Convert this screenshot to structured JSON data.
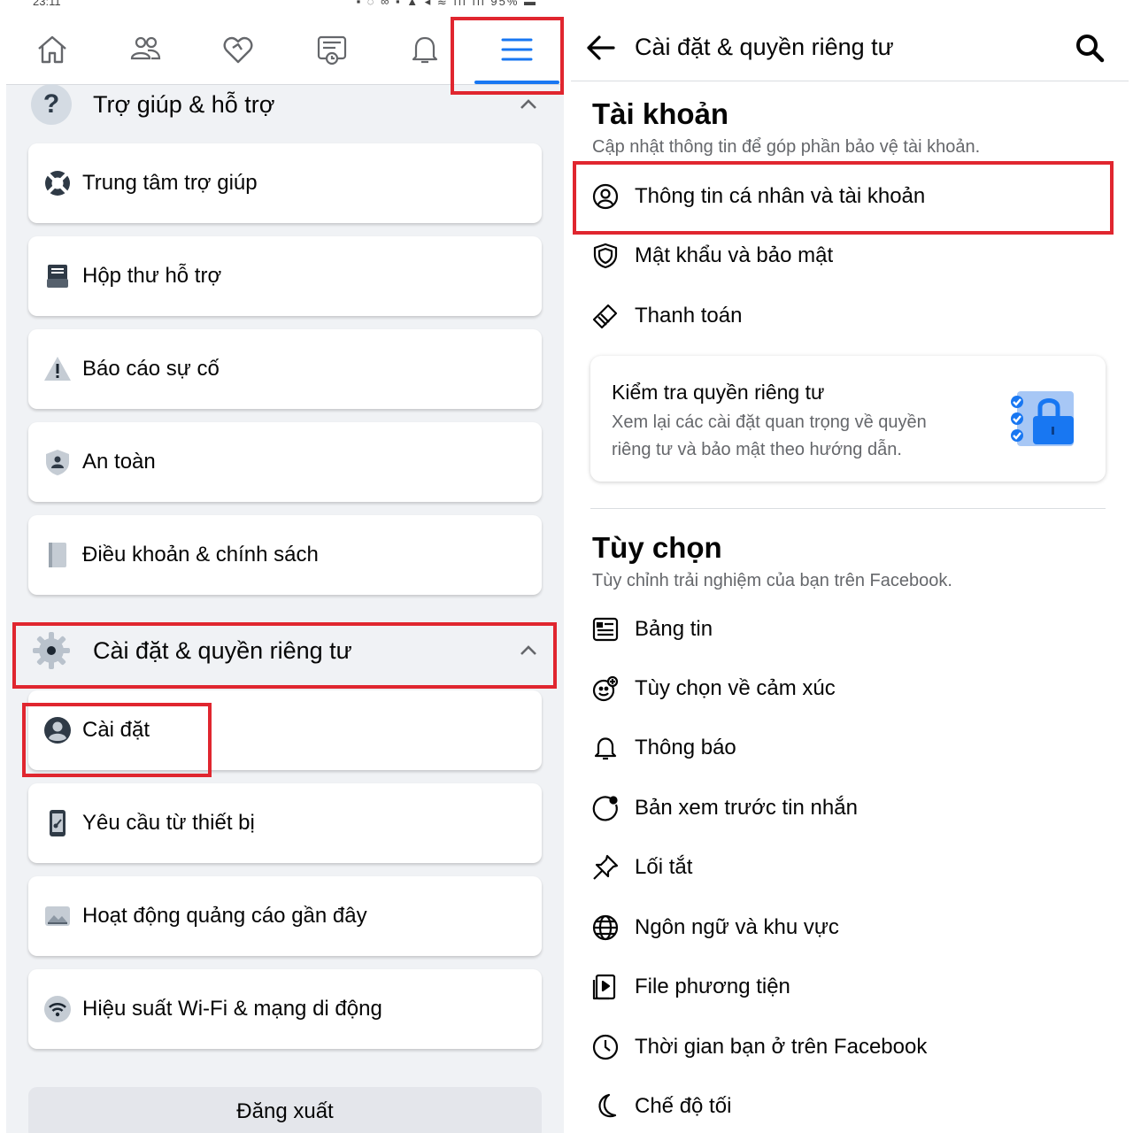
{
  "statusbar": {
    "time": "23:11",
    "icons": "▪ ◌ ∞     ▪ ▲ ◂ ≋ ıll ıll 95% ▬"
  },
  "nav": {
    "tabs": [
      {
        "name": "home-icon"
      },
      {
        "name": "friends-icon"
      },
      {
        "name": "dating-heart-icon"
      },
      {
        "name": "memories-icon"
      },
      {
        "name": "bell-icon"
      },
      {
        "name": "menu-icon",
        "active": true
      }
    ]
  },
  "left": {
    "help_section": {
      "title": "Trợ giúp & hỗ trợ",
      "items": [
        {
          "label": "Trung tâm trợ giúp",
          "icon": "lifebuoy-icon"
        },
        {
          "label": "Hộp thư hỗ trợ",
          "icon": "inbox-icon"
        },
        {
          "label": "Báo cáo sự cố",
          "icon": "warning-icon"
        },
        {
          "label": "An toàn",
          "icon": "shield-person-icon"
        },
        {
          "label": "Điều khoản & chính sách",
          "icon": "book-icon"
        }
      ]
    },
    "settings_section": {
      "title": "Cài đặt & quyền riêng tư",
      "items": [
        {
          "label": "Cài đặt",
          "icon": "profile-circle-icon"
        },
        {
          "label": "Yêu cầu từ thiết bị",
          "icon": "phone-key-icon"
        },
        {
          "label": "Hoạt động quảng cáo gần đây",
          "icon": "ad-image-icon"
        },
        {
          "label": "Hiệu suất Wi-Fi & mạng di động",
          "icon": "wifi-icon"
        }
      ]
    },
    "logout_label": "Đăng xuất"
  },
  "right": {
    "header_title": "Cài đặt & quyền riêng tư",
    "account": {
      "title": "Tài khoản",
      "subtitle": "Cập nhật thông tin để góp phần bảo vệ tài khoản.",
      "items": [
        {
          "label": "Thông tin cá nhân và tài khoản",
          "icon": "user-circle-icon"
        },
        {
          "label": "Mật khẩu và bảo mật",
          "icon": "shield-icon"
        },
        {
          "label": "Thanh toán",
          "icon": "payment-tag-icon"
        }
      ]
    },
    "privacy_card": {
      "title": "Kiểm tra quyền riêng tư",
      "description": "Xem lại các cài đặt quan trọng về quyền riêng tư và bảo mật theo hướng dẫn."
    },
    "preferences": {
      "title": "Tùy chọn",
      "subtitle": "Tùy chỉnh trải nghiệm của bạn trên Facebook.",
      "items": [
        {
          "label": "Bảng tin",
          "icon": "news-feed-icon"
        },
        {
          "label": "Tùy chọn về cảm xúc",
          "icon": "reaction-icon"
        },
        {
          "label": "Thông báo",
          "icon": "bell-icon"
        },
        {
          "label": "Bản xem trước tin nhắn",
          "icon": "message-preview-icon"
        },
        {
          "label": "Lối tắt",
          "icon": "pin-icon"
        },
        {
          "label": "Ngôn ngữ và khu vực",
          "icon": "globe-icon"
        },
        {
          "label": "File phương tiện",
          "icon": "media-file-icon"
        },
        {
          "label": "Thời gian bạn ở trên Facebook",
          "icon": "clock-icon"
        },
        {
          "label": "Chế độ tối",
          "icon": "moon-icon"
        }
      ]
    }
  },
  "colors": {
    "highlight": "#e0262f",
    "accent": "#1877f2",
    "panel_bg": "#f0f2f5",
    "secondary_text": "#65676b"
  }
}
